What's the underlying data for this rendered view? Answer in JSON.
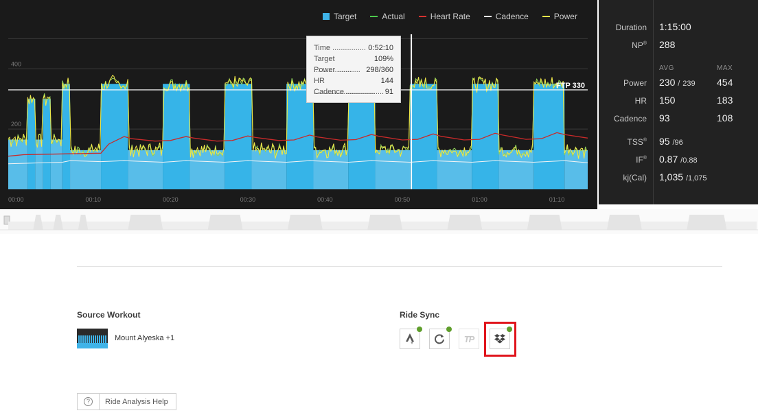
{
  "legend": [
    {
      "label": "Target",
      "color": "#3fb3e8",
      "kind": "swatch"
    },
    {
      "label": "Actual",
      "color": "#4dc94d",
      "kind": "line"
    },
    {
      "label": "Heart Rate",
      "color": "#d8322f",
      "kind": "line"
    },
    {
      "label": "Cadence",
      "color": "#ffffff",
      "kind": "line"
    },
    {
      "label": "Power",
      "color": "#f2e84a",
      "kind": "line"
    }
  ],
  "chart_data": {
    "type": "area",
    "x_unit": "elapsed time",
    "xticks": [
      "00:00",
      "00:10",
      "00:20",
      "00:30",
      "00:40",
      "00:50",
      "01:00",
      "01:10"
    ],
    "xrange_minutes": [
      0,
      75
    ],
    "yticks": [
      200,
      400
    ],
    "ylim": [
      0,
      560
    ],
    "ftp": {
      "label": "FTP 330",
      "value": 330
    },
    "cursor_minute": 52.17,
    "target_segments": [
      {
        "start": 0,
        "end": 2.5,
        "value": 165
      },
      {
        "start": 2.5,
        "end": 3.5,
        "value": 300
      },
      {
        "start": 3.5,
        "end": 4.5,
        "value": 165
      },
      {
        "start": 4.5,
        "end": 5.5,
        "value": 300
      },
      {
        "start": 5.5,
        "end": 7,
        "value": 165
      },
      {
        "start": 7,
        "end": 8,
        "value": 350
      },
      {
        "start": 8,
        "end": 12,
        "value": 130
      },
      {
        "start": 12,
        "end": 15.5,
        "value": 350
      },
      {
        "start": 15.5,
        "end": 20,
        "value": 130
      },
      {
        "start": 20,
        "end": 23.5,
        "value": 350
      },
      {
        "start": 23.5,
        "end": 28,
        "value": 130
      },
      {
        "start": 28,
        "end": 31.5,
        "value": 350
      },
      {
        "start": 31.5,
        "end": 36,
        "value": 130
      },
      {
        "start": 36,
        "end": 39.5,
        "value": 350
      },
      {
        "start": 39.5,
        "end": 44,
        "value": 130
      },
      {
        "start": 44,
        "end": 47.5,
        "value": 350
      },
      {
        "start": 47.5,
        "end": 52,
        "value": 130
      },
      {
        "start": 52,
        "end": 55.5,
        "value": 350
      },
      {
        "start": 55.5,
        "end": 60,
        "value": 130
      },
      {
        "start": 60,
        "end": 63.5,
        "value": 350
      },
      {
        "start": 63.5,
        "end": 68,
        "value": 130
      },
      {
        "start": 68,
        "end": 72,
        "value": 350
      },
      {
        "start": 72,
        "end": 75,
        "value": 130
      }
    ],
    "heart_rate": [
      [
        0,
        110
      ],
      [
        2,
        115
      ],
      [
        8,
        118
      ],
      [
        12,
        120
      ],
      [
        13,
        150
      ],
      [
        15,
        175
      ],
      [
        16,
        168
      ],
      [
        19,
        160
      ],
      [
        21,
        162
      ],
      [
        23,
        175
      ],
      [
        24,
        170
      ],
      [
        27,
        160
      ],
      [
        29,
        162
      ],
      [
        31,
        177
      ],
      [
        32,
        172
      ],
      [
        35,
        162
      ],
      [
        37,
        164
      ],
      [
        39,
        180
      ],
      [
        40,
        174
      ],
      [
        43,
        163
      ],
      [
        45,
        165
      ],
      [
        47,
        182
      ],
      [
        48,
        176
      ],
      [
        51,
        164
      ],
      [
        53,
        166
      ],
      [
        55,
        184
      ],
      [
        56,
        176
      ],
      [
        59,
        164
      ],
      [
        61,
        166
      ],
      [
        63,
        186
      ],
      [
        64,
        180
      ],
      [
        67,
        166
      ],
      [
        69,
        168
      ],
      [
        71,
        188
      ],
      [
        72,
        182
      ],
      [
        75,
        170
      ]
    ],
    "cadence": [
      [
        0,
        85
      ],
      [
        7,
        90
      ],
      [
        8,
        95
      ],
      [
        12,
        92
      ],
      [
        15,
        95
      ],
      [
        20,
        90
      ],
      [
        23,
        95
      ],
      [
        28,
        90
      ],
      [
        31,
        95
      ],
      [
        36,
        90
      ],
      [
        39,
        95
      ],
      [
        44,
        90
      ],
      [
        47,
        95
      ],
      [
        52,
        90
      ],
      [
        55,
        95
      ],
      [
        60,
        90
      ],
      [
        63,
        95
      ],
      [
        68,
        90
      ],
      [
        72,
        95
      ],
      [
        75,
        88
      ]
    ]
  },
  "tooltip": [
    {
      "label": "Time ................",
      "value": "0:52:10"
    },
    {
      "label": "Target ..................",
      "value": "109%"
    },
    {
      "label": "Power ...........",
      "value": "298/360"
    },
    {
      "label": "HR .............................",
      "value": "144"
    },
    {
      "label": "Cadence ..................",
      "value": "91"
    }
  ],
  "stats": {
    "duration_label": "Duration",
    "duration_value": "1:15:00",
    "np_label": "NP",
    "np_value": "288",
    "avg_head": "AVG",
    "max_head": "MAX",
    "rows": [
      {
        "label": "Power",
        "avg": "230",
        "avg_alt": "239",
        "max": "454"
      },
      {
        "label": "HR",
        "avg": "150",
        "avg_alt": "",
        "max": "183"
      },
      {
        "label": "Cadence",
        "avg": "93",
        "avg_alt": "",
        "max": "108"
      }
    ],
    "tss_label": "TSS",
    "tss_value": "95",
    "tss_alt": "96",
    "if_label": "IF",
    "if_value": "0.87",
    "if_alt": "0.88",
    "kj_label": "kj(Cal)",
    "kj_value": "1,035",
    "kj_alt": "1,075",
    "trademark": "®",
    "slash": "/"
  },
  "source_workout": {
    "title": "Source Workout",
    "name": "Mount Alyeska +1"
  },
  "ride_sync": {
    "title": "Ride Sync",
    "services": [
      {
        "icon": "strava-icon",
        "connected": true
      },
      {
        "icon": "sync-icon",
        "connected": true
      },
      {
        "icon": "trainingpeaks-icon",
        "connected": false
      },
      {
        "icon": "dropbox-icon",
        "connected": true
      }
    ],
    "tp_text": "TP"
  },
  "help": {
    "icon_text": "?",
    "label": "Ride Analysis Help"
  }
}
